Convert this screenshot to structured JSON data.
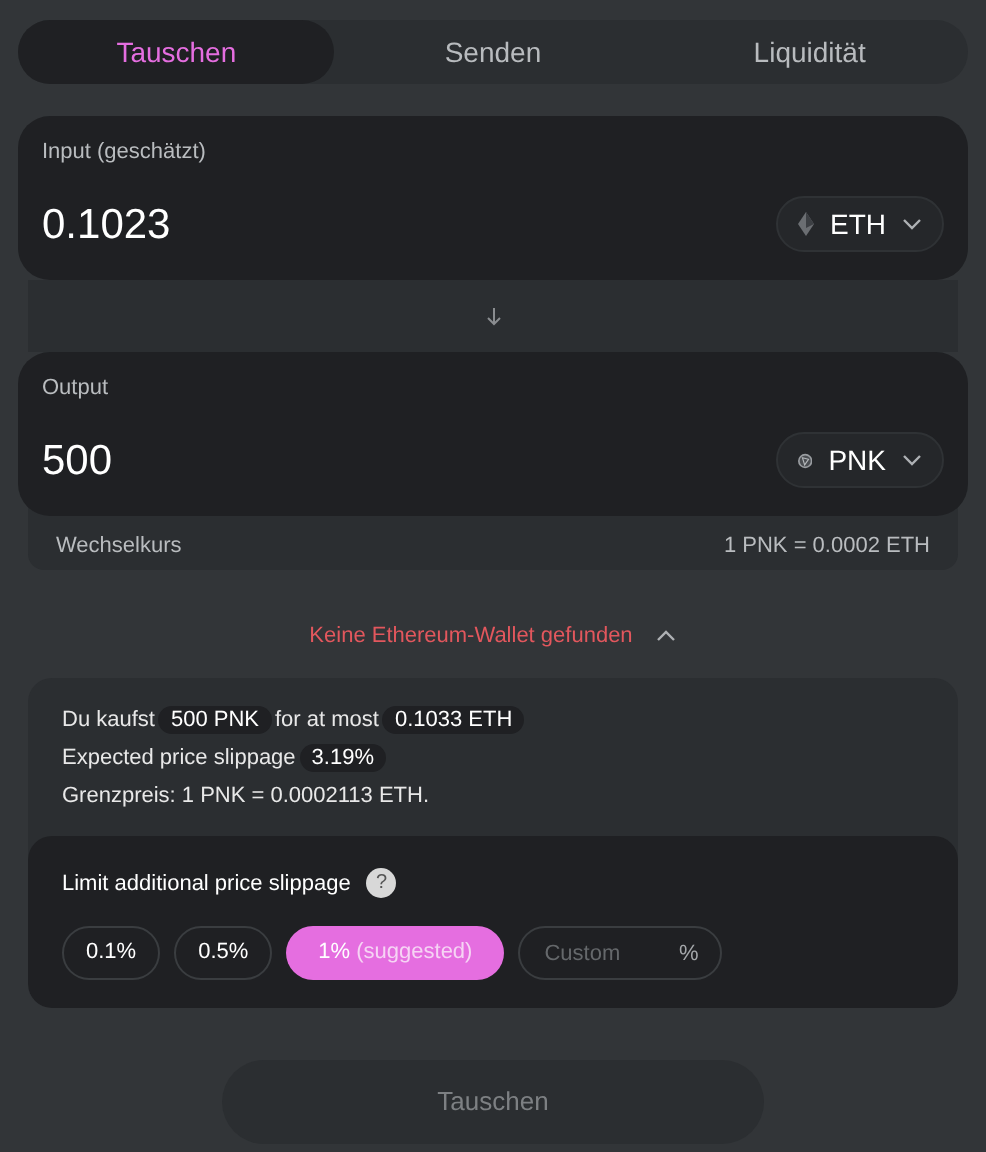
{
  "tabs": [
    {
      "label": "Tauschen",
      "selected": true
    },
    {
      "label": "Senden",
      "selected": false
    },
    {
      "label": "Liquidität",
      "selected": false
    }
  ],
  "input": {
    "label": "Input (geschätzt)",
    "value": "0.1023",
    "token": {
      "symbol": "ETH",
      "kind": "eth"
    }
  },
  "output": {
    "label": "Output",
    "value": "500",
    "token": {
      "symbol": "PNK",
      "kind": "pnk"
    }
  },
  "rate": {
    "label": "Wechselkurs",
    "value": "1 PNK = 0.0002 ETH"
  },
  "warning": {
    "text": "Keine Ethereum-Wallet gefunden",
    "expanded": true
  },
  "summary": [
    {
      "parts": [
        {
          "text": "Du kaufst",
          "highlight": false
        },
        {
          "text": "500 PNK",
          "highlight": true
        },
        {
          "text": "for at most",
          "highlight": false
        },
        {
          "text": "0.1033 ETH",
          "highlight": true
        }
      ]
    },
    {
      "parts": [
        {
          "text": "Expected price slippage",
          "highlight": false
        },
        {
          "text": "3.19%",
          "highlight": true
        }
      ]
    },
    {
      "parts": [
        {
          "text": "Grenzpreis: 1 PNK = 0.0002113 ETH.",
          "highlight": false
        }
      ]
    }
  ],
  "slippage": {
    "label": "Limit additional price slippage",
    "help": "?",
    "options": [
      {
        "label": "0.1%",
        "selected": false
      },
      {
        "label": "0.5%",
        "selected": false
      },
      {
        "label": "1%",
        "note": "(suggested)",
        "selected": true
      }
    ],
    "custom": {
      "placeholder": "Custom",
      "unit": "%"
    }
  },
  "submit": {
    "label": "Tauschen",
    "disabled": true
  }
}
